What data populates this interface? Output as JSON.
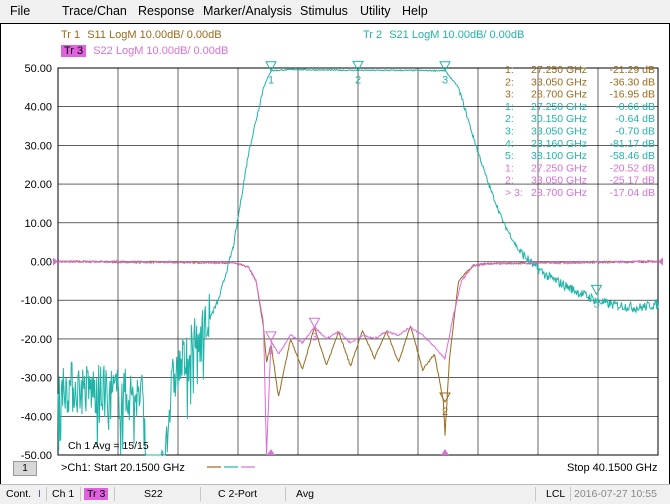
{
  "menu": [
    "File",
    "Trace/Chan",
    "Response",
    "Marker/Analysis",
    "Stimulus",
    "Utility",
    "Help"
  ],
  "traces": {
    "tr1": {
      "box": "Tr 1",
      "text": "S11 LogM 10.00dB/  0.00dB",
      "color": "#9a6a1c"
    },
    "tr2": {
      "box": "Tr 2",
      "text": "S21 LogM 10.00dB/  0.00dB",
      "color": "#20b4a8"
    },
    "tr3": {
      "box": "Tr 3",
      "text": "S22 LogM 10.00dB/  0.00dB",
      "color": "#d870d8"
    }
  },
  "chart_data": {
    "type": "line",
    "xlim": [
      20.15,
      40.15
    ],
    "ylim": [
      -50,
      50
    ],
    "x_unit": "GHz",
    "y_unit": "dB",
    "grid": true,
    "y_ticks": [
      50,
      40,
      30,
      20,
      10,
      0,
      -10,
      -20,
      -30,
      -40,
      -50
    ],
    "y_tick_labels": [
      "50.00",
      "40.00",
      "30.00",
      "20.00",
      "10.00",
      "0.00",
      "-10.00",
      "-20.00",
      "-30.00",
      "-40.00",
      "-50.00"
    ],
    "series": [
      {
        "name": "S11",
        "color": "#9a6a1c",
        "x": [
          20.15,
          26.0,
          26.5,
          26.75,
          27.0,
          27.1,
          27.25,
          27.5,
          27.9,
          28.3,
          28.7,
          29.1,
          29.5,
          29.9,
          30.3,
          30.7,
          31.1,
          31.5,
          31.9,
          32.3,
          32.7,
          33.0,
          33.05,
          33.2,
          33.5,
          34.0,
          34.5,
          40.15
        ],
        "y": [
          0,
          -0.3,
          -1.5,
          -5,
          -17,
          -26,
          -21.3,
          -35,
          -20,
          -28,
          -16.9,
          -27,
          -18,
          -27,
          -18,
          -25,
          -18,
          -26,
          -16.5,
          -28,
          -24,
          -36.3,
          -45,
          -25,
          -5,
          -1,
          -0.5,
          0
        ]
      },
      {
        "name": "S21",
        "color": "#20b4a8",
        "x": [
          20.15,
          21.0,
          22.0,
          23.0,
          23.16,
          24.0,
          24.5,
          25.0,
          25.5,
          26.0,
          26.5,
          27.0,
          27.25,
          28.0,
          28.7,
          30.15,
          31.5,
          33.05,
          33.5,
          34.0,
          34.5,
          35.0,
          35.5,
          36.0,
          36.5,
          37.0,
          37.5,
          38.1,
          38.5,
          39.0,
          39.5,
          40.15
        ],
        "y": [
          -32,
          -33,
          -34,
          -35,
          -81.2,
          -30,
          -24,
          -18,
          -10,
          4,
          28,
          45,
          49.3,
          49.6,
          49.5,
          49.4,
          49.4,
          49.3,
          45,
          32,
          20,
          10,
          3,
          -1,
          -4,
          -6,
          -8,
          -10,
          -11,
          -11.5,
          -12,
          -11
        ]
      },
      {
        "name": "S22",
        "color": "#d870d8",
        "x": [
          20.15,
          26.0,
          26.5,
          26.75,
          27.0,
          27.1,
          27.25,
          27.5,
          27.9,
          28.3,
          28.7,
          29.1,
          29.5,
          29.9,
          30.3,
          30.7,
          31.1,
          31.5,
          31.9,
          32.3,
          32.7,
          33.05,
          33.3,
          33.6,
          34.0,
          34.5,
          40.15
        ],
        "y": [
          0,
          -0.3,
          -1.5,
          -5,
          -16,
          -50,
          -20.5,
          -24,
          -19,
          -21,
          -17,
          -20,
          -18,
          -21,
          -19,
          -20,
          -18,
          -19,
          -17,
          -19,
          -22,
          -25.2,
          -15,
          -5,
          -1,
          -0.5,
          0
        ]
      }
    ],
    "markers": [
      {
        "trace": "S21",
        "label": "1",
        "x": 27.25,
        "y": 49.3
      },
      {
        "trace": "S21",
        "label": "2",
        "x": 30.15,
        "y": 49.4
      },
      {
        "trace": "S21",
        "label": "3",
        "x": 33.05,
        "y": 49.3
      },
      {
        "trace": "S21",
        "label": "5",
        "x": 38.1,
        "y": -8.5
      },
      {
        "trace": "S11",
        "label": "2",
        "x": 33.05,
        "y": -36.3
      },
      {
        "trace": "S22",
        "label": "3",
        "x": 28.7,
        "y": -17.0
      },
      {
        "trace": "S22",
        "label": "1",
        "x": 27.25,
        "y": -20.5
      }
    ]
  },
  "marker_table": [
    {
      "num": "1:",
      "freq": "27.250 GHz",
      "val": "-21.29 dB",
      "color": "#9a6a1c"
    },
    {
      "num": "2:",
      "freq": "33.050 GHz",
      "val": "-36.30 dB",
      "color": "#9a6a1c"
    },
    {
      "num": "3:",
      "freq": "28.700 GHz",
      "val": "-16.95 dB",
      "color": "#9a6a1c"
    },
    {
      "num": "1:",
      "freq": "27.250 GHz",
      "val": "-0.66 dB",
      "color": "#20b4a8"
    },
    {
      "num": "2:",
      "freq": "30.150 GHz",
      "val": "-0.64 dB",
      "color": "#20b4a8"
    },
    {
      "num": "3:",
      "freq": "33.050 GHz",
      "val": "-0.70 dB",
      "color": "#20b4a8"
    },
    {
      "num": "4:",
      "freq": "23.160 GHz",
      "val": "-81.17 dB",
      "color": "#20b4a8"
    },
    {
      "num": "5:",
      "freq": "38.100 GHz",
      "val": "-58.46 dB",
      "color": "#20b4a8"
    },
    {
      "num": "1:",
      "freq": "27.250 GHz",
      "val": "-20.52 dB",
      "color": "#d870d8"
    },
    {
      "num": "2:",
      "freq": "33.050 GHz",
      "val": "-25.17 dB",
      "color": "#d870d8"
    },
    {
      "num": "> 3:",
      "freq": "28.700 GHz",
      "val": "-17.04 dB",
      "color": "#d870d8"
    }
  ],
  "avg_text": "Ch 1 Avg =   15/15",
  "channel_number": "1",
  "start_text": ">Ch1:  Start  20.1500 GHz",
  "stop_text": "Stop  40.1500 GHz",
  "status": {
    "cont": "Cont.",
    "ch": "Ch 1",
    "tr": "Tr 3",
    "param": "S22",
    "cal": "C  2-Port",
    "avg": "Avg",
    "lcl": "LCL",
    "datetime": "2016-07-27 10:55"
  }
}
